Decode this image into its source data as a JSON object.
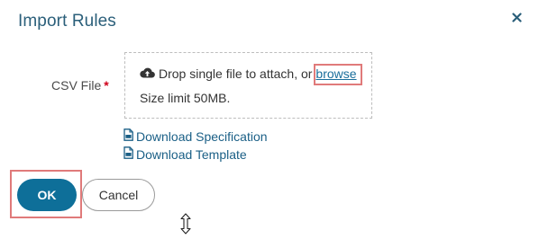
{
  "dialog": {
    "title": "Import Rules",
    "close_icon": "close-icon"
  },
  "form": {
    "csv_label": "CSV File",
    "required_marker": "*",
    "dropzone": {
      "icon": "cloud-upload-icon",
      "prompt": "Drop single file to attach, or",
      "browse_label": "browse",
      "size_limit": "Size limit 50MB."
    },
    "links": [
      {
        "icon": "document-icon",
        "label": "Download Specification"
      },
      {
        "icon": "document-icon",
        "label": "Download Template"
      }
    ]
  },
  "actions": {
    "ok_label": "OK",
    "cancel_label": "Cancel"
  },
  "colors": {
    "title": "#2b5f7a",
    "primary": "#0e6f99",
    "link": "#1a5f86",
    "required": "#d0021b",
    "highlight": "#e07a7a"
  }
}
